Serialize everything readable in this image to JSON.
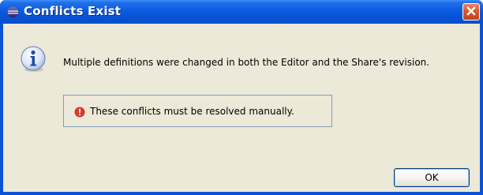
{
  "window": {
    "title": "Conflicts Exist",
    "app_icon": "eclipse-icon",
    "close_icon": "close-icon",
    "accent_color": "#0a53d8"
  },
  "dialog": {
    "icon": "info-icon",
    "message": "Multiple definitions were changed in both the Editor and the Share's revision.",
    "status": {
      "icon": "error-icon",
      "text": "These conflicts must be resolved manually.",
      "color": "#d23b2b"
    }
  },
  "buttons": {
    "ok_label": "OK"
  }
}
